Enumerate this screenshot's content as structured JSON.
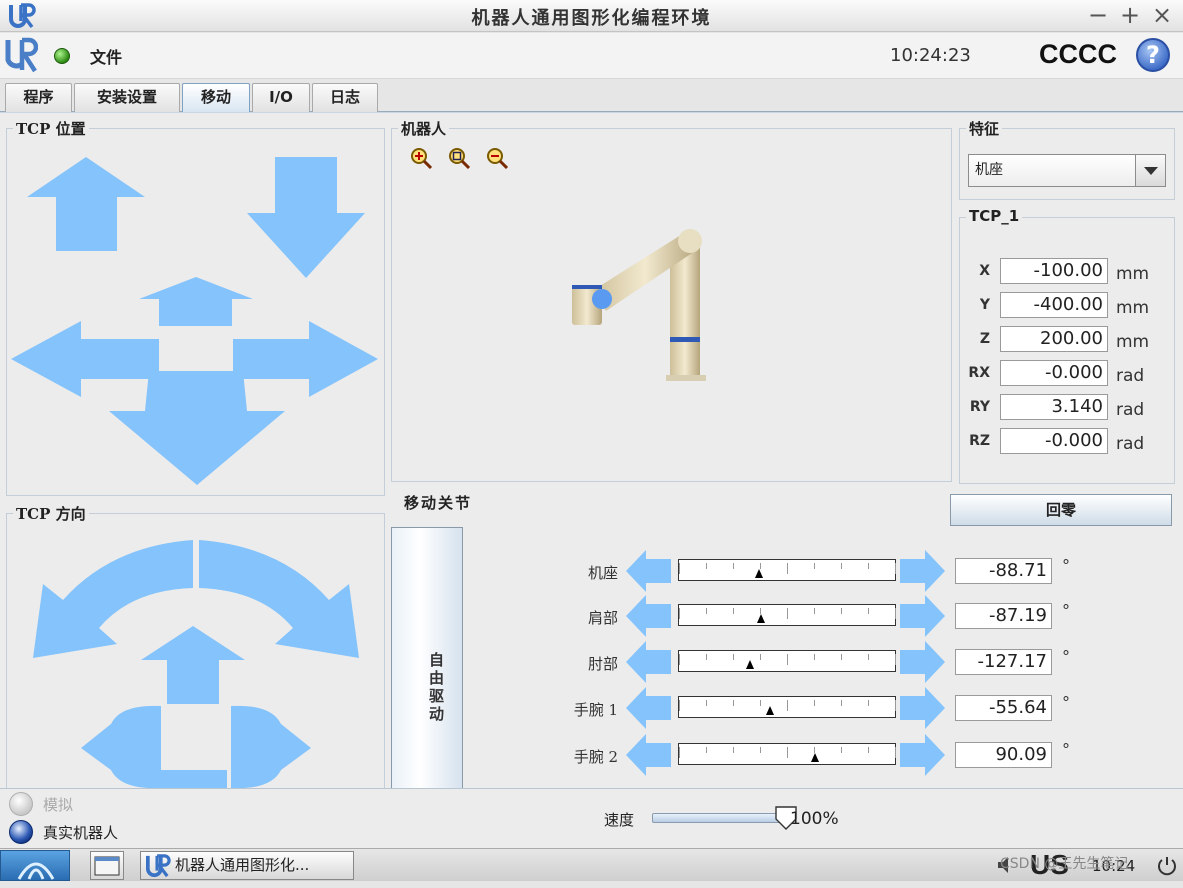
{
  "window": {
    "title": "机器人通用图形化编程环境",
    "minimize": "−",
    "maximize": "+",
    "close": "×"
  },
  "menubar": {
    "logo": "UR",
    "file_menu": "文件",
    "clock": "10:24:23",
    "robot_name": "CCCC",
    "help": "?"
  },
  "tabs": [
    {
      "label": "程序",
      "active": false
    },
    {
      "label": "安装设置",
      "active": false
    },
    {
      "label": "移动",
      "active": true
    },
    {
      "label": "I/O",
      "active": false
    },
    {
      "label": "日志",
      "active": false
    }
  ],
  "tcp_position": {
    "title": "TCP 位置"
  },
  "tcp_orientation": {
    "title": "TCP 方向"
  },
  "robot_view": {
    "title": "机器人",
    "zoom_in_icon": "zoom-in-icon",
    "zoom_fit_icon": "zoom-fit-icon",
    "zoom_out_icon": "zoom-out-icon"
  },
  "feature": {
    "title": "特征",
    "selected": "机座"
  },
  "tcp": {
    "title": "TCP_1",
    "fields": [
      {
        "label": "X",
        "value": "-100.00",
        "unit": "mm"
      },
      {
        "label": "Y",
        "value": "-400.00",
        "unit": "mm"
      },
      {
        "label": "Z",
        "value": "200.00",
        "unit": "mm"
      },
      {
        "label": "RX",
        "value": "-0.000",
        "unit": "rad"
      },
      {
        "label": "RY",
        "value": "3.140",
        "unit": "rad"
      },
      {
        "label": "RZ",
        "value": "-0.000",
        "unit": "rad"
      }
    ]
  },
  "move_joints": {
    "title": "移动关节",
    "home_button": "回零",
    "freedrive_button": "自由驱动",
    "unit": "°",
    "joints": [
      {
        "name": "机座",
        "value": "-88.71",
        "position": 0.37
      },
      {
        "name": "肩部",
        "value": "-87.19",
        "position": 0.38
      },
      {
        "name": "肘部",
        "value": "-127.17",
        "position": 0.33
      },
      {
        "name": "手腕 1",
        "value": "-55.64",
        "position": 0.42
      },
      {
        "name": "手腕 2",
        "value": "90.09",
        "position": 0.63
      }
    ]
  },
  "bottom": {
    "simulation_label": "模拟",
    "real_robot_label": "真实机器人",
    "speed_label": "速度",
    "speed_value": "100%",
    "speed_fraction": 1.0
  },
  "taskbar": {
    "window_button": "机器人通用图形化...",
    "keyboard": "US",
    "tray_time": "10:24",
    "watermark": "CSDN @王先生笔记"
  },
  "colors": {
    "arrow": "#84c3fb",
    "accent_blue": "#2e5ab5",
    "status_green": "#3aa31b"
  }
}
